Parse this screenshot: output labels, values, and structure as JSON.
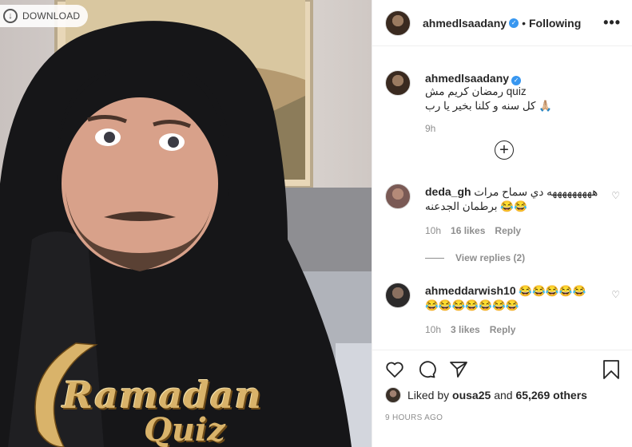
{
  "photo": {
    "download_label": "DOWNLOAD",
    "overlay_line1": "Ramadan",
    "overlay_line2": "Quiz"
  },
  "header": {
    "username": "ahmedlsaadany",
    "verified": true,
    "separator": "•",
    "follow_status": "Following",
    "more_icon": "more-horizontal-icon"
  },
  "caption": {
    "username": "ahmedlsaadany",
    "text": "رمضان كريم مش quiz\nكل سنه و كلنا بخير يا رب 🙏🏼",
    "time": "9h"
  },
  "load_more_icon": "plus-circle-icon",
  "comments": [
    {
      "username": "deda_gh",
      "text": "هههههههههه دي سماح مرات برطمان الجدعنه 😂😂",
      "time": "10h",
      "likes": "16 likes",
      "reply": "Reply",
      "view_replies": "View replies (2)"
    },
    {
      "username": "ahmeddarwish10",
      "text": "😂😂😂😂😂😂😂😂😂😂😂😂",
      "time": "10h",
      "likes": "3 likes",
      "reply": "Reply"
    }
  ],
  "actions": {
    "icons": [
      "heart-icon",
      "comment-icon",
      "share-icon",
      "bookmark-icon"
    ],
    "liked_by_prefix": "Liked by",
    "liked_by_user": "ousa25",
    "liked_by_and": "and",
    "liked_by_count": "65,269 others",
    "timestamp": "9 HOURS AGO"
  },
  "colors": {
    "verified_blue": "#3897f0",
    "secondary_text": "#8e8e8e",
    "border": "#efefef",
    "gold": "#d9b36a"
  }
}
